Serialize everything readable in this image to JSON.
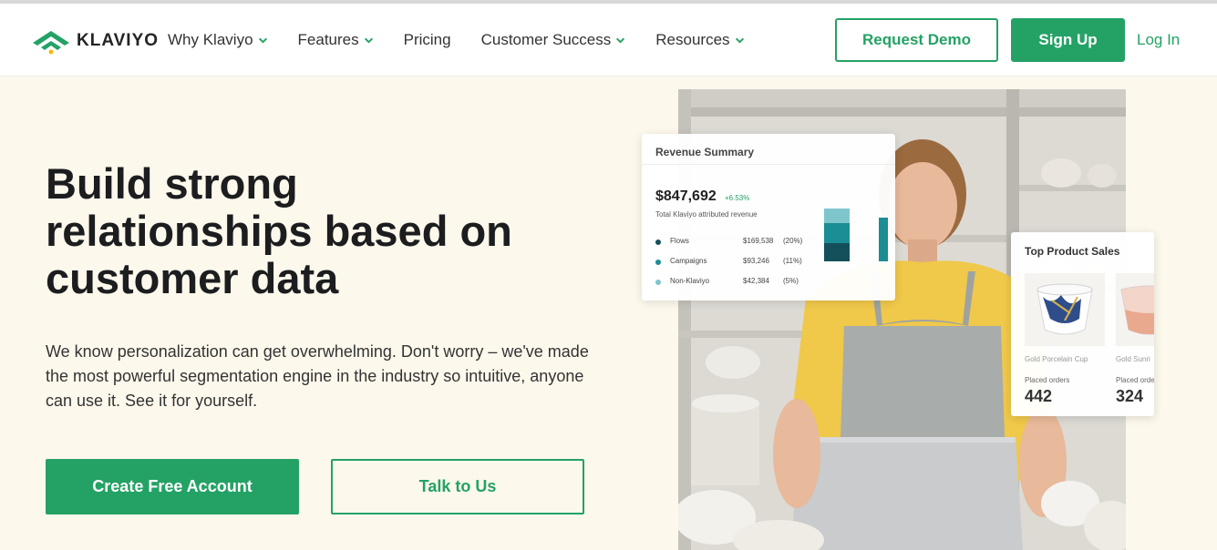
{
  "brand": {
    "name": "KLAVIYO",
    "logo": "klaviyo-wifi-logo",
    "accent": "#24a265"
  },
  "nav": {
    "items": [
      {
        "label": "Why Klaviyo",
        "has_dropdown": true
      },
      {
        "label": "Features",
        "has_dropdown": true
      },
      {
        "label": "Pricing",
        "has_dropdown": false
      },
      {
        "label": "Customer Success",
        "has_dropdown": true
      },
      {
        "label": "Resources",
        "has_dropdown": true
      }
    ],
    "request_demo": "Request Demo",
    "sign_up": "Sign Up",
    "log_in": "Log In"
  },
  "hero": {
    "headline": "Build strong relationships based on customer data",
    "subtext": "We know personalization can get overwhelming. Don't worry – we've made the most powerful segmentation engine in the industry so intuitive, anyone can use it. See it for yourself.",
    "primary_cta": "Create Free Account",
    "secondary_cta": "Talk to Us"
  },
  "revenue_summary": {
    "title": "Revenue Summary",
    "total": "$847,692",
    "change": "+6.53%",
    "caption": "Total Klaviyo attributed revenue",
    "rows": [
      {
        "label": "Flows",
        "amount": "$169,538",
        "percent": "(20%)",
        "color": "#13505b"
      },
      {
        "label": "Campaigns",
        "amount": "$93,246",
        "percent": "(11%)",
        "color": "#1b8d94"
      },
      {
        "label": "Non-Klaviyo",
        "amount": "$42,384",
        "percent": "(5%)",
        "color": "#7fc6cc"
      }
    ]
  },
  "top_products": {
    "title": "Top Product Sales",
    "placed_label": "Placed orders",
    "products": [
      {
        "name": "Gold Porcelain Cup",
        "orders": "442"
      },
      {
        "name": "Gold Sunri",
        "orders": "324"
      }
    ]
  }
}
